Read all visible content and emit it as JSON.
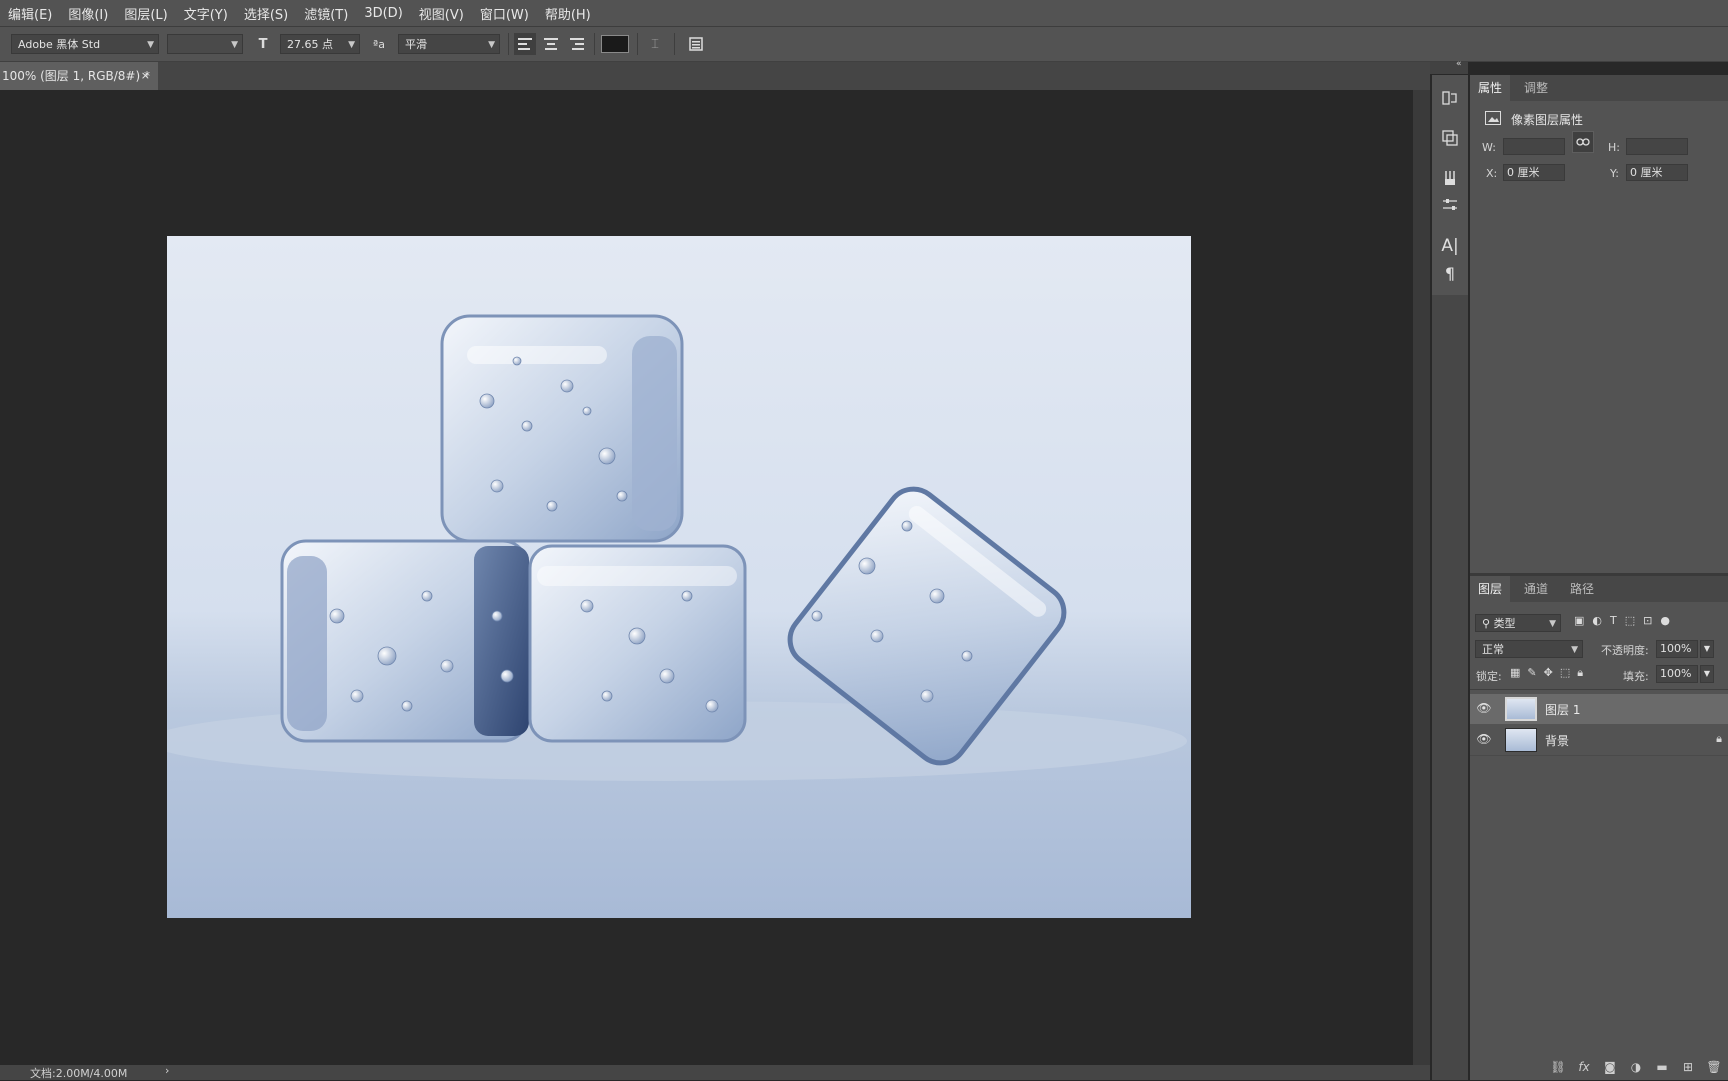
{
  "menu": [
    "编辑(E)",
    "图像(I)",
    "图层(L)",
    "文字(Y)",
    "选择(S)",
    "滤镜(T)",
    "3D(D)",
    "视图(V)",
    "窗口(W)",
    "帮助(H)"
  ],
  "options": {
    "font_family": "Adobe 黑体 Std",
    "font_size": "27.65 点",
    "antialias_prefix": "ªa",
    "antialias": "平滑",
    "text_color": "#1a1a1a"
  },
  "document": {
    "tab_title": "100% (图层 1, RGB/8#) *",
    "close": "×",
    "status": "文档:2.00M/4.00M",
    "status_arrow": "›"
  },
  "properties": {
    "tabs": [
      "属性",
      "调整"
    ],
    "title": "像素图层属性",
    "w_label": "W:",
    "h_label": "H:",
    "x_label": "X:",
    "y_label": "Y:",
    "x_value": "0 厘米",
    "y_value": "0 厘米",
    "w_value": "",
    "h_value": ""
  },
  "layers_panel": {
    "tabs": [
      "图层",
      "通道",
      "路径"
    ],
    "filter_type": "类型",
    "blend_mode": "正常",
    "opacity_label": "不透明度:",
    "opacity_value": "100%",
    "lock_label": "锁定:",
    "fill_label": "填充:",
    "fill_value": "100%",
    "layers": [
      {
        "name": "图层 1",
        "selected": true,
        "locked": false
      },
      {
        "name": "背景",
        "selected": false,
        "locked": true
      }
    ]
  },
  "colors": {
    "menu_bg": "#535353",
    "workspace_bg": "#282828",
    "selected_layer_bg": "#6a6a6a"
  }
}
